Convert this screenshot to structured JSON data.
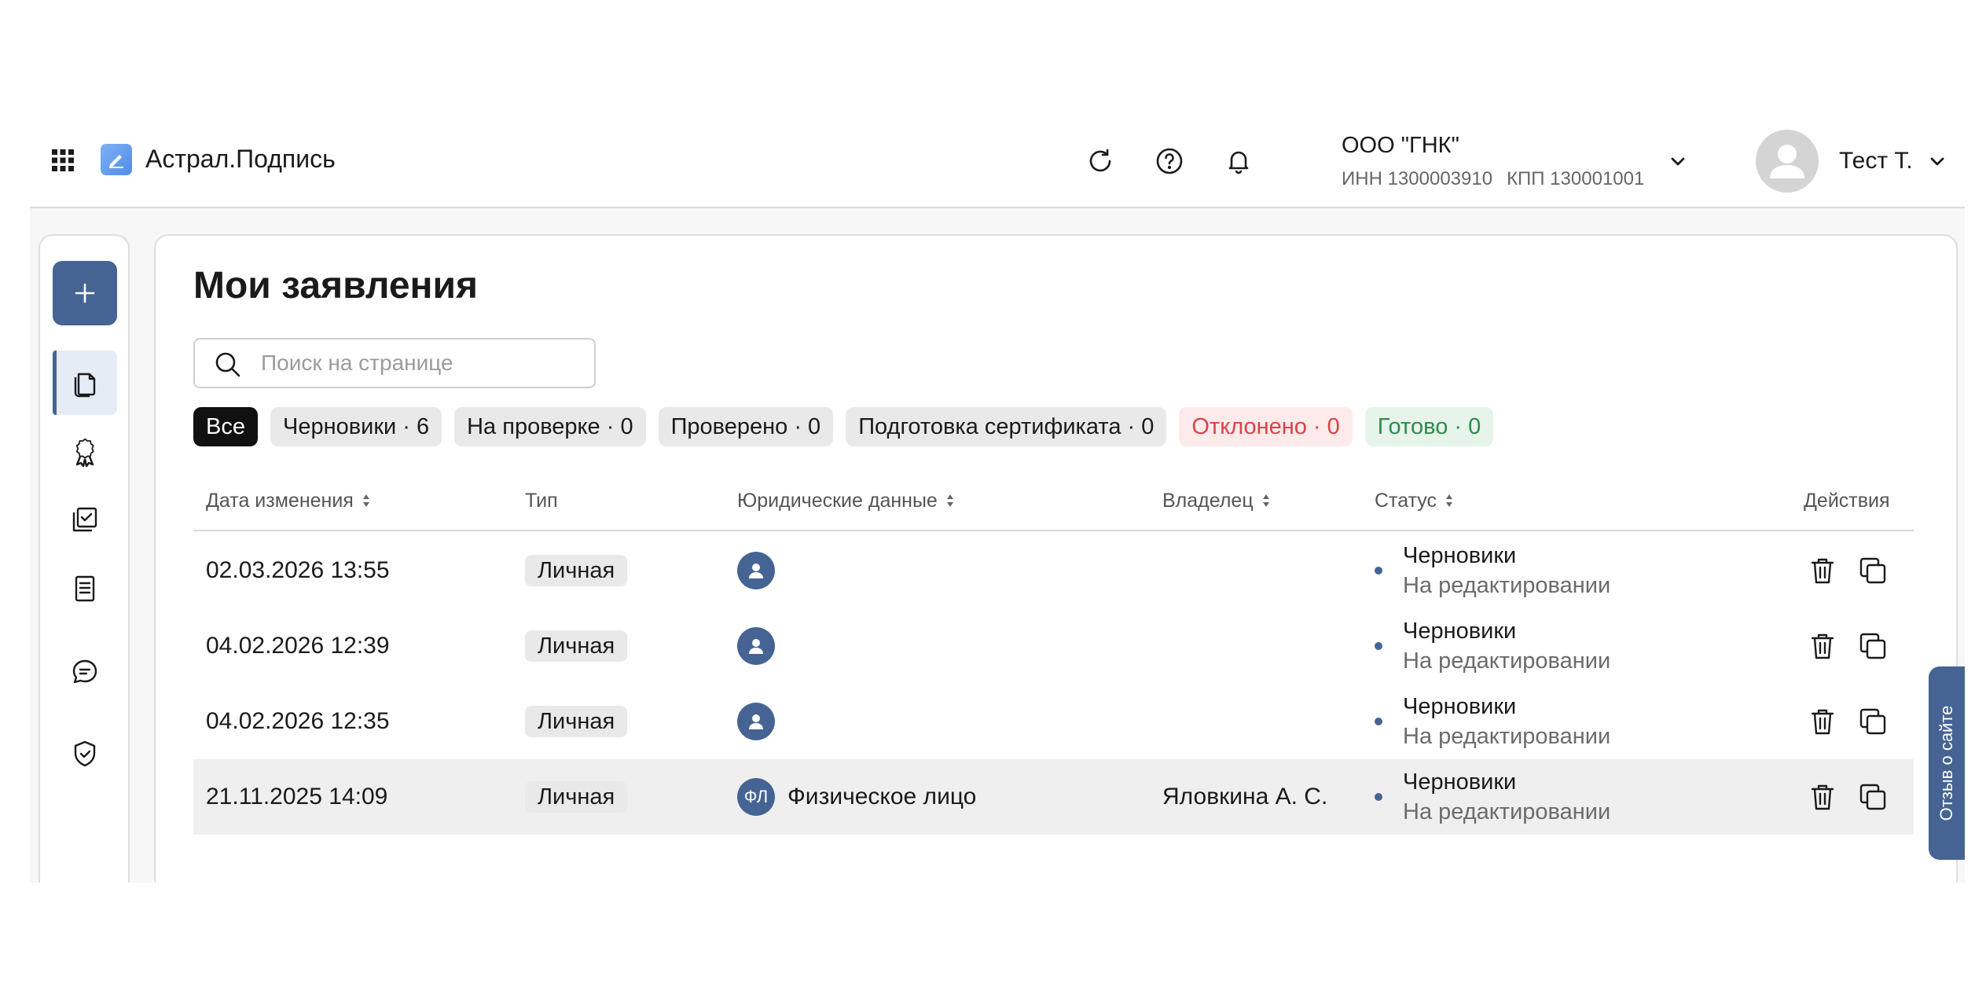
{
  "header": {
    "app_title": "Астрал.Подпись",
    "organization": {
      "name": "ООО \"ГНК\"",
      "inn": "ИНН 1300003910",
      "kpp": "КПП 130001001"
    },
    "user": {
      "name": "Тест Т."
    },
    "icons": [
      "apps-grid-icon",
      "refresh-icon",
      "help-icon",
      "bell-icon",
      "chevron-down-icon",
      "user-avatar-icon"
    ]
  },
  "sidebar": {
    "add_button": {
      "icon": "plus-icon"
    },
    "items": [
      {
        "icon": "documents-icon",
        "active": true
      },
      {
        "icon": "award-icon",
        "active": false
      },
      {
        "icon": "checklist-icon",
        "active": false
      },
      {
        "icon": "document-icon",
        "active": false
      },
      {
        "icon": "chat-icon",
        "active": false
      },
      {
        "icon": "shield-check-icon",
        "active": false
      }
    ]
  },
  "main": {
    "title": "Мои заявления",
    "search": {
      "placeholder": "Поиск на странице",
      "value": ""
    },
    "filters": [
      {
        "label": "Все",
        "selected": true
      },
      {
        "label": "Черновики · 6",
        "selected": false
      },
      {
        "label": "На проверке · 0",
        "selected": false
      },
      {
        "label": "Проверено · 0",
        "selected": false
      },
      {
        "label": "Подготовка сертификата · 0",
        "selected": false
      },
      {
        "label": "Отклонено · 0",
        "selected": false,
        "color": "#d9424a"
      },
      {
        "label": "Готово · 0",
        "selected": false,
        "color": "#2f8a4c"
      }
    ],
    "table": {
      "columns": [
        {
          "label": "Дата изменения",
          "sortable": true
        },
        {
          "label": "Тип",
          "sortable": false
        },
        {
          "label": "Юридические данные",
          "sortable": true
        },
        {
          "label": "Владелец",
          "sortable": true
        },
        {
          "label": "Статус",
          "sortable": true
        },
        {
          "label": "Действия",
          "sortable": false
        }
      ],
      "rows": [
        {
          "date": "02.03.2026 13:55",
          "type": "Личная",
          "legal_avatar": "person-icon",
          "legal_name": "",
          "owner": "",
          "status": "Черновики",
          "substatus": "На редактировании"
        },
        {
          "date": "04.02.2026 12:39",
          "type": "Личная",
          "legal_avatar": "person-icon",
          "legal_name": "",
          "owner": "",
          "status": "Черновики",
          "substatus": "На редактировании"
        },
        {
          "date": "04.02.2026 12:35",
          "type": "Личная",
          "legal_avatar": "person-icon",
          "legal_name": "",
          "owner": "",
          "status": "Черновики",
          "substatus": "На редактировании"
        },
        {
          "date": "21.11.2025 14:09",
          "type": "Личная",
          "legal_avatar_text": "ФЛ",
          "legal_name": "Физическое лицо",
          "owner": "Яловкина А. С.",
          "status": "Черновики",
          "substatus": "На редактировании",
          "highlighted": true
        }
      ],
      "actions": [
        "trash-icon",
        "copy-icon"
      ]
    }
  },
  "feedback_tab": {
    "label": "Отзыв о сайте"
  },
  "colors": {
    "accent": "#456494",
    "rejected": "#d9424a",
    "done": "#2f8a4c"
  }
}
